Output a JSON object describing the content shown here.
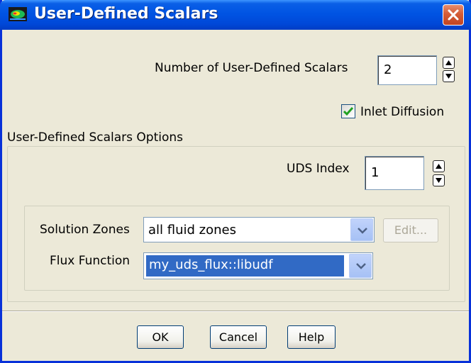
{
  "window": {
    "title": "User-Defined Scalars"
  },
  "scalars": {
    "count_label": "Number of User-Defined Scalars",
    "count_value": "2",
    "inlet_diffusion_label": "Inlet Diffusion",
    "inlet_diffusion_checked": true
  },
  "options": {
    "group_label": "User-Defined Scalars Options",
    "uds_index_label": "UDS Index",
    "uds_index_value": "1",
    "solution_zones_label": "Solution Zones",
    "solution_zones_value": "all fluid zones",
    "edit_label": "Edit...",
    "flux_function_label": "Flux Function",
    "flux_function_value": "my_uds_flux::libudf"
  },
  "buttons": {
    "ok": "OK",
    "cancel": "Cancel",
    "help": "Help"
  },
  "colors": {
    "titlebar": "#0054e3",
    "selection": "#316ac5",
    "close": "#d45c36",
    "dialog_bg": "#ece9d8"
  }
}
